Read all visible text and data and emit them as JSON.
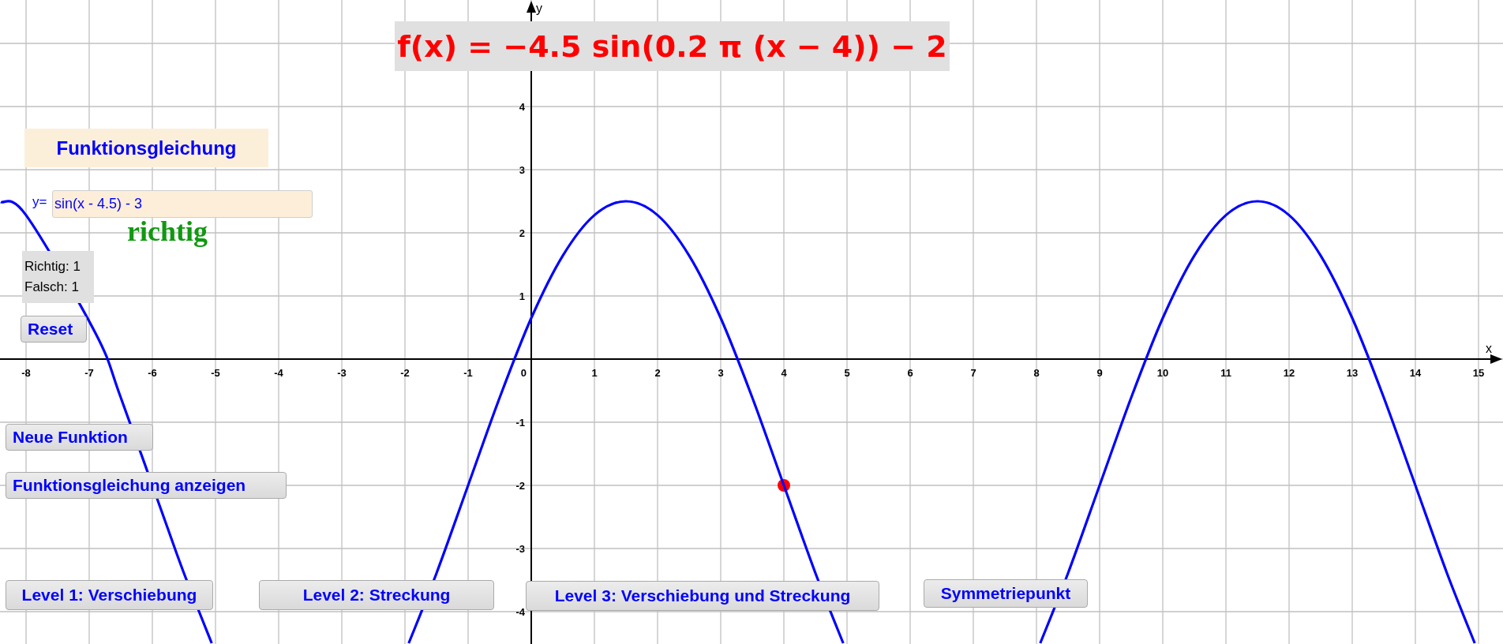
{
  "formula": "f(x) = −4.5 sin(0.2 π (x − 4)) − 2",
  "heading": "Funktionsgleichung",
  "input": {
    "label": "y=",
    "value": "sin(x - 4.5) - 3"
  },
  "feedback": "richtig",
  "score": [
    "Richtig: 1",
    "Falsch: 1"
  ],
  "buttons": [
    {
      "label": "Reset"
    },
    {
      "label": "Neue Funktion"
    },
    {
      "label": "Funktionsgleichung anzeigen"
    },
    {
      "label": "Level 1: Verschiebung"
    },
    {
      "label": "Level 2: Streckung"
    },
    {
      "label": "Level 3: Verschiebung und Streckung"
    },
    {
      "label": "Symmetriepunkt"
    }
  ],
  "chart_data": {
    "type": "line",
    "xlabel": "x",
    "ylabel": "y",
    "grid": true,
    "xlim": [
      -8.4125,
      15.3875
    ],
    "ylim": [
      -4.5125,
      5.6875
    ],
    "xticks": [
      -8,
      -7,
      -6,
      -5,
      -4,
      -3,
      -2,
      -1,
      0,
      1,
      2,
      3,
      4,
      5,
      6,
      7,
      8,
      9,
      10,
      11,
      12,
      13,
      14,
      15
    ],
    "yticks": [
      -4,
      -3,
      -2,
      -1,
      1,
      2,
      3,
      4
    ],
    "x": [
      -8.4,
      -8,
      -6.9,
      -6.5,
      -5.8,
      -5.5,
      -5.06,
      -3.5,
      -1.94,
      -1.5,
      -1,
      -0.5,
      0,
      0.5,
      1,
      1.5,
      2,
      2.5,
      3,
      3.5,
      4,
      4.5,
      4.94,
      6.5,
      8.06,
      8.5,
      9,
      9.5,
      10,
      10.5,
      11,
      11.5,
      12,
      12.5,
      13,
      13.5,
      14,
      14.5,
      14.94
    ],
    "series": [
      {
        "color": "#0000ff",
        "values": [
          2.49,
          2.28,
          0.41,
          -0.61,
          -2.56,
          -3.39,
          -4.5,
          null,
          -4.5,
          -3.39,
          -2,
          -0.61,
          0.65,
          1.64,
          2.28,
          2.5,
          2.28,
          1.64,
          0.65,
          -0.61,
          -2,
          -3.39,
          -4.5,
          null,
          -4.5,
          -3.39,
          -2,
          -0.61,
          0.65,
          1.64,
          2.28,
          2.5,
          2.28,
          1.64,
          0.65,
          -0.61,
          -2,
          -3.39,
          -4.5
        ]
      },
      {
        "color": "#ff0000",
        "marker": true,
        "values": [
          null,
          null,
          null,
          null,
          null,
          null,
          null,
          null,
          null,
          null,
          null,
          null,
          null,
          null,
          null,
          null,
          null,
          null,
          null,
          null,
          -2,
          null,
          null,
          null,
          null,
          null,
          null,
          null,
          null,
          null,
          null,
          null,
          null,
          null,
          null,
          null,
          null,
          null,
          null
        ]
      }
    ]
  }
}
